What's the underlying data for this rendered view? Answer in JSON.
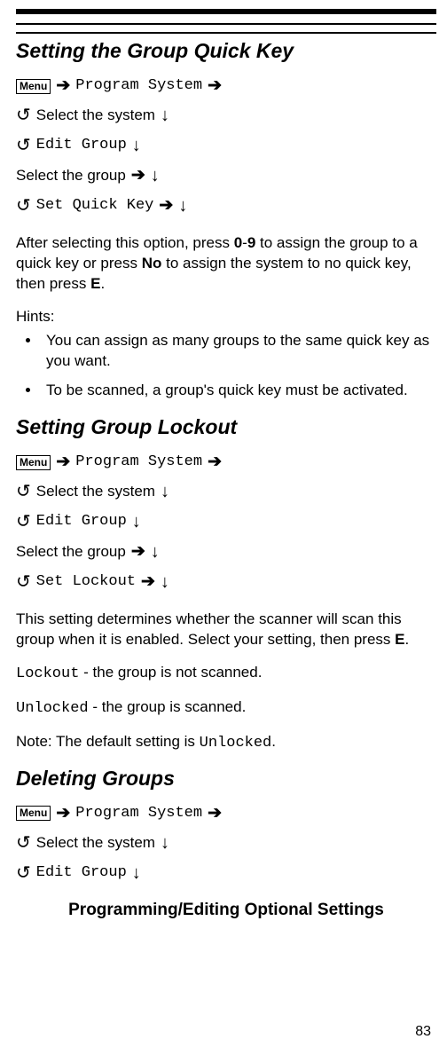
{
  "menu_label": "Menu",
  "arrows": {
    "right": "➔",
    "down": "↓",
    "rotate": "↺"
  },
  "nav": {
    "program_system": "Program System",
    "select_system": "Select the system",
    "edit_group": "Edit Group",
    "select_group": "Select the group",
    "set_quick_key": "Set Quick Key",
    "set_lockout": "Set Lockout"
  },
  "sec1": {
    "heading": "Setting the Group Quick Key",
    "para1_a": "After selecting this option, press ",
    "para1_b": "0",
    "para1_c": "-",
    "para1_d": "9",
    "para1_e": " to assign the group to a quick key or press ",
    "para1_f": "No",
    "para1_g": " to assign the system to no quick key, then press ",
    "para1_h": "E",
    "para1_i": ".",
    "hints_label": "Hints:",
    "hint1": "You can assign as many groups to the same quick key as you want.",
    "hint2": "To be scanned, a group's quick key must be activated."
  },
  "sec2": {
    "heading": "Setting Group Lockout",
    "para1_a": "This setting determines whether the scanner will scan this group when it is enabled. Select your setting, then press ",
    "para1_b": "E",
    "para1_c": ".",
    "lockout_label": "Lockout",
    "lockout_desc": " - the group is not scanned.",
    "unlocked_label": "Unlocked",
    "unlocked_desc": " - the group is scanned.",
    "note_a": "Note: The default setting is ",
    "note_b": "Unlocked",
    "note_c": "."
  },
  "sec3": {
    "heading": "Deleting Groups"
  },
  "footer": "Programming/Editing Optional Settings",
  "page_number": "83"
}
